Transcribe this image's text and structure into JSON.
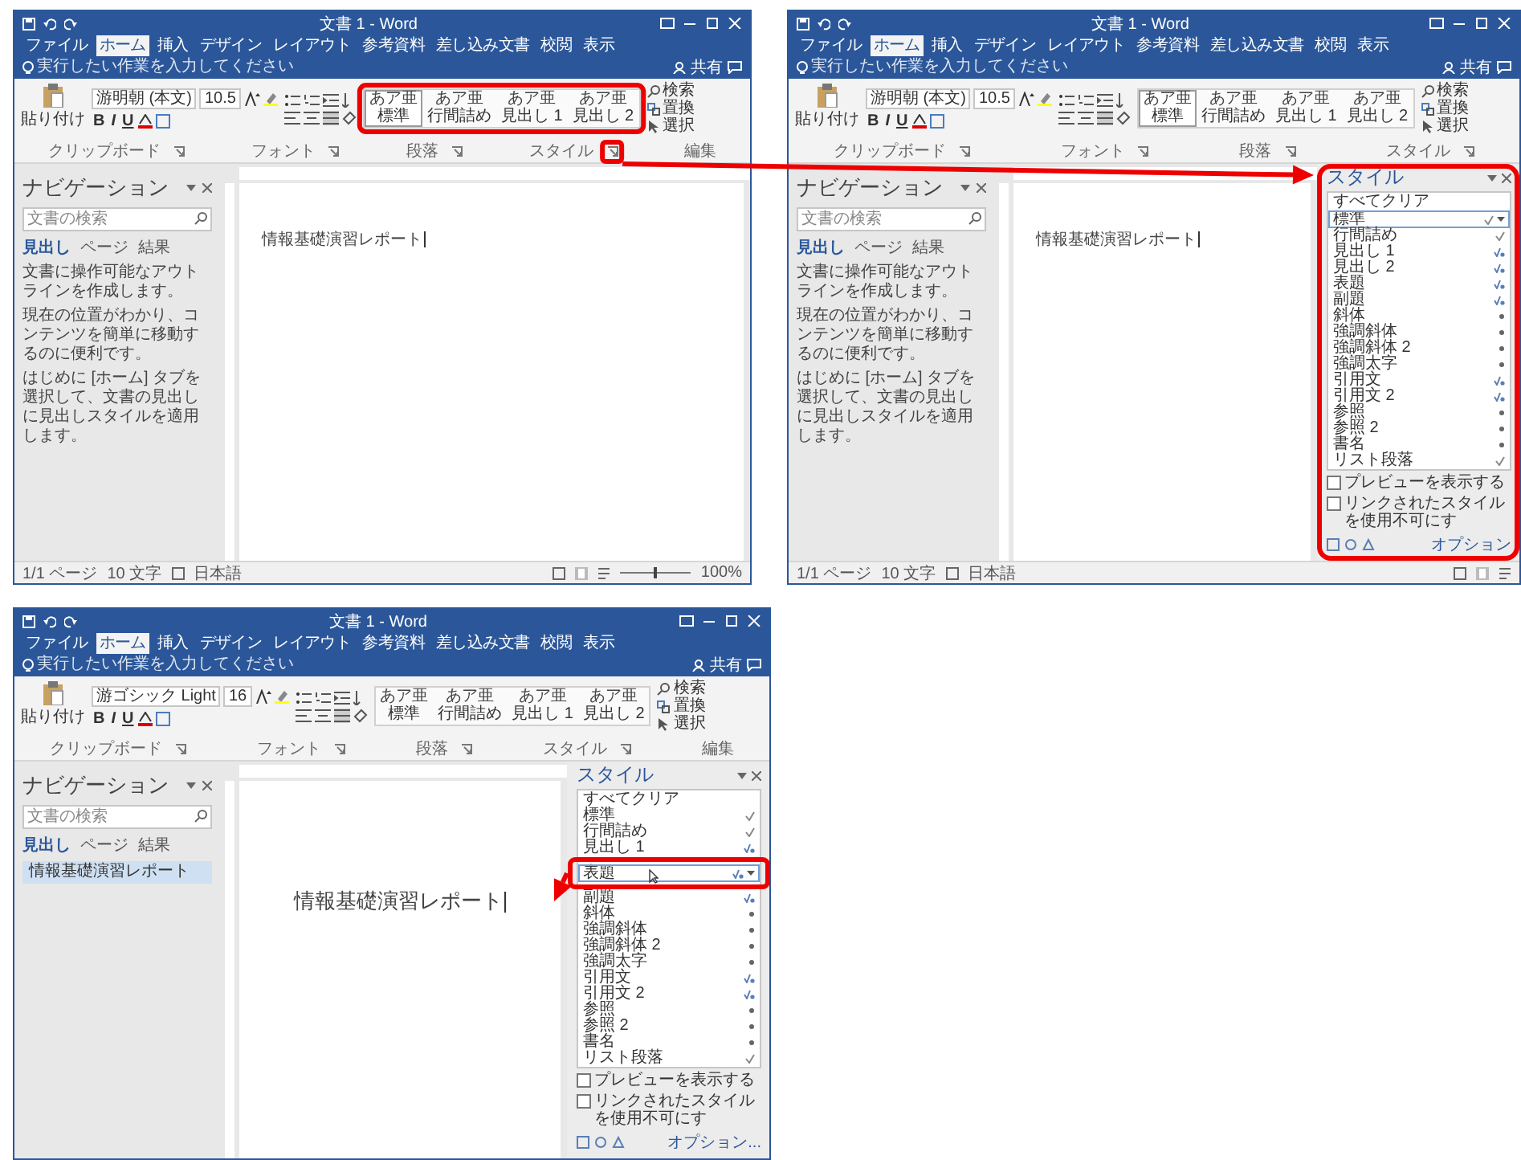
{
  "windows": [
    {
      "title": "文書 1 - Word",
      "share": "共有",
      "tabs": [
        {
          "label": "ファイル",
          "selected": false
        },
        {
          "label": "ホーム",
          "selected": true
        },
        {
          "label": "挿入",
          "selected": false
        },
        {
          "label": "デザイン",
          "selected": false
        },
        {
          "label": "レイアウト",
          "selected": false
        },
        {
          "label": "参考資料",
          "selected": false
        },
        {
          "label": "差し込み文書",
          "selected": false
        },
        {
          "label": "校閲",
          "selected": false
        },
        {
          "label": "表示",
          "selected": false
        }
      ],
      "tell_me": "実行したい作業を入力してください",
      "paste": "貼り付け",
      "font_name": "游明朝 (本文)",
      "font_size": "10.5",
      "format_buttons": [
        "B",
        "I",
        "U"
      ],
      "gallery": [
        {
          "sample": "あア亜",
          "name": "標準",
          "selected": true
        },
        {
          "sample": "あア亜",
          "name": "行間詰め",
          "selected": false
        },
        {
          "sample": "あア亜",
          "name": "見出し 1",
          "selected": false
        },
        {
          "sample": "あア亜",
          "name": "見出し 2",
          "selected": false
        }
      ],
      "editing": [
        "検索",
        "置換",
        "選択"
      ],
      "group_labels": [
        "クリップボード",
        "フォント",
        "段落",
        "スタイル",
        "編集"
      ],
      "nav": {
        "title": "ナビゲーション",
        "search_placeholder": "文書の検索",
        "tabs": [
          {
            "label": "見出し",
            "selected": true
          },
          {
            "label": "ページ",
            "selected": false
          },
          {
            "label": "結果",
            "selected": false
          }
        ],
        "messages": [
          "文書に操作可能なアウトラインを作成します。",
          "現在の位置がわかり、コンテンツを簡単に移動するのに便利です。",
          "はじめに [ホーム] タブを選択して、文書の見出しに見出しスタイルを適用します。"
        ]
      },
      "document": {
        "text": "情報基礎演習レポート",
        "kind": "normal"
      },
      "status": {
        "pages": "1/1 ページ",
        "words": "10 文字",
        "language": "日本語",
        "zoom": {
          "level": 0.5,
          "reading": "100%"
        }
      }
    },
    {
      "title": "文書 1 - Word",
      "share": "共有",
      "tabs": [
        {
          "label": "ファイル",
          "selected": false
        },
        {
          "label": "ホーム",
          "selected": true
        },
        {
          "label": "挿入",
          "selected": false
        },
        {
          "label": "デザイン",
          "selected": false
        },
        {
          "label": "レイアウト",
          "selected": false
        },
        {
          "label": "参考資料",
          "selected": false
        },
        {
          "label": "差し込み文書",
          "selected": false
        },
        {
          "label": "校閲",
          "selected": false
        },
        {
          "label": "表示",
          "selected": false
        }
      ],
      "tell_me": "実行したい作業を入力してください",
      "paste": "貼り付け",
      "font_name": "游明朝 (本文)",
      "font_size": "10.5",
      "format_buttons": [
        "B",
        "I",
        "U"
      ],
      "gallery": [
        {
          "sample": "あア亜",
          "name": "標準",
          "selected": true
        },
        {
          "sample": "あア亜",
          "name": "行間詰め",
          "selected": false
        },
        {
          "sample": "あア亜",
          "name": "見出し 1",
          "selected": false
        },
        {
          "sample": "あア亜",
          "name": "見出し 2",
          "selected": false
        }
      ],
      "editing": [
        "検索",
        "置換",
        "選択"
      ],
      "group_labels": [
        "クリップボード",
        "フォント",
        "段落",
        "スタイル"
      ],
      "nav": {
        "title": "ナビゲーション",
        "search_placeholder": "文書の検索",
        "tabs": [
          {
            "label": "見出し",
            "selected": true
          },
          {
            "label": "ページ",
            "selected": false
          },
          {
            "label": "結果",
            "selected": false
          }
        ],
        "messages": [
          "文書に操作可能なアウトラインを作成します。",
          "現在の位置がわかり、コンテンツを簡単に移動するのに便利です。",
          "はじめに [ホーム] タブを選択して、文書の見出しに見出しスタイルを適用します。"
        ]
      },
      "document": {
        "text": "情報基礎演習レポート",
        "kind": "normal"
      },
      "styles_pane": {
        "title": "スタイル",
        "clear_all": "すべてクリア",
        "items": [
          {
            "label": "標準",
            "kind": "paragraph",
            "selected": true
          },
          {
            "label": "行間詰め",
            "kind": "paragraph",
            "selected": false
          },
          {
            "label": "見出し 1",
            "kind": "linked",
            "selected": false
          },
          {
            "label": "見出し 2",
            "kind": "linked",
            "selected": false
          },
          {
            "label": "表題",
            "kind": "linked",
            "selected": false
          },
          {
            "label": "副題",
            "kind": "linked",
            "selected": false
          },
          {
            "label": "斜体",
            "kind": "character",
            "selected": false
          },
          {
            "label": "強調斜体",
            "kind": "character",
            "selected": false
          },
          {
            "label": "強調斜体 2",
            "kind": "character",
            "selected": false
          },
          {
            "label": "強調太字",
            "kind": "character",
            "selected": false
          },
          {
            "label": "引用文",
            "kind": "linked",
            "selected": false
          },
          {
            "label": "引用文 2",
            "kind": "linked",
            "selected": false
          },
          {
            "label": "参照",
            "kind": "character",
            "selected": false
          },
          {
            "label": "参照 2",
            "kind": "character",
            "selected": false
          },
          {
            "label": "書名",
            "kind": "character",
            "selected": false
          },
          {
            "label": "リスト段落",
            "kind": "paragraph",
            "selected": false
          }
        ],
        "preview_label": "プレビューを表示する",
        "preview_checked": false,
        "linked_label": "リンクされたスタイルを使用不可にす",
        "linked_checked": false,
        "options": "オプション"
      },
      "status": {
        "pages": "1/1 ページ",
        "words": "10 文字",
        "language": "日本語"
      }
    },
    {
      "title": "文書 1 - Word",
      "share": "共有",
      "tabs": [
        {
          "label": "ファイル",
          "selected": false
        },
        {
          "label": "ホーム",
          "selected": true
        },
        {
          "label": "挿入",
          "selected": false
        },
        {
          "label": "デザイン",
          "selected": false
        },
        {
          "label": "レイアウト",
          "selected": false
        },
        {
          "label": "参考資料",
          "selected": false
        },
        {
          "label": "差し込み文書",
          "selected": false
        },
        {
          "label": "校閲",
          "selected": false
        },
        {
          "label": "表示",
          "selected": false
        }
      ],
      "tell_me": "実行したい作業を入力してください",
      "paste": "貼り付け",
      "font_name": "游ゴシック Light",
      "font_size": "16",
      "format_buttons": [
        "B",
        "I",
        "U"
      ],
      "gallery": [
        {
          "sample": "あア亜",
          "name": "標準",
          "selected": false
        },
        {
          "sample": "あア亜",
          "name": "行間詰め",
          "selected": false
        },
        {
          "sample": "あア亜",
          "name": "見出し 1",
          "selected": false
        },
        {
          "sample": "あア亜",
          "name": "見出し 2",
          "selected": false
        }
      ],
      "editing": [
        "検索",
        "置換",
        "選択"
      ],
      "group_labels": [
        "クリップボード",
        "フォント",
        "段落",
        "スタイル",
        "編集"
      ],
      "nav": {
        "title": "ナビゲーション",
        "search_placeholder": "文書の検索",
        "tabs": [
          {
            "label": "見出し",
            "selected": true
          },
          {
            "label": "ページ",
            "selected": false
          },
          {
            "label": "結果",
            "selected": false
          }
        ],
        "results": [
          {
            "label": "情報基礎演習レポート",
            "selected": true
          }
        ]
      },
      "document": {
        "text": "情報基礎演習レポート",
        "kind": "title"
      },
      "styles_pane": {
        "title": "スタイル",
        "clear_all": "すべてクリア",
        "items": [
          {
            "label": "標準",
            "kind": "paragraph",
            "selected": false
          },
          {
            "label": "行間詰め",
            "kind": "paragraph",
            "selected": false
          },
          {
            "label": "見出し 1",
            "kind": "linked",
            "selected": false
          },
          {
            "label": "表題",
            "kind": "linked",
            "selected": true
          },
          {
            "label": "副題",
            "kind": "linked",
            "selected": false
          },
          {
            "label": "斜体",
            "kind": "character",
            "selected": false
          },
          {
            "label": "強調斜体",
            "kind": "character",
            "selected": false
          },
          {
            "label": "強調斜体 2",
            "kind": "character",
            "selected": false
          },
          {
            "label": "強調太字",
            "kind": "character",
            "selected": false
          },
          {
            "label": "引用文",
            "kind": "linked",
            "selected": false
          },
          {
            "label": "引用文 2",
            "kind": "linked",
            "selected": false
          },
          {
            "label": "参照",
            "kind": "character",
            "selected": false
          },
          {
            "label": "参照 2",
            "kind": "character",
            "selected": false
          },
          {
            "label": "書名",
            "kind": "character",
            "selected": false
          },
          {
            "label": "リスト段落",
            "kind": "paragraph",
            "selected": false
          }
        ],
        "preview_label": "プレビューを表示する",
        "preview_checked": false,
        "linked_label": "リンクされたスタイルを使用不可にす",
        "linked_checked": false,
        "options": "オプション..."
      }
    }
  ]
}
